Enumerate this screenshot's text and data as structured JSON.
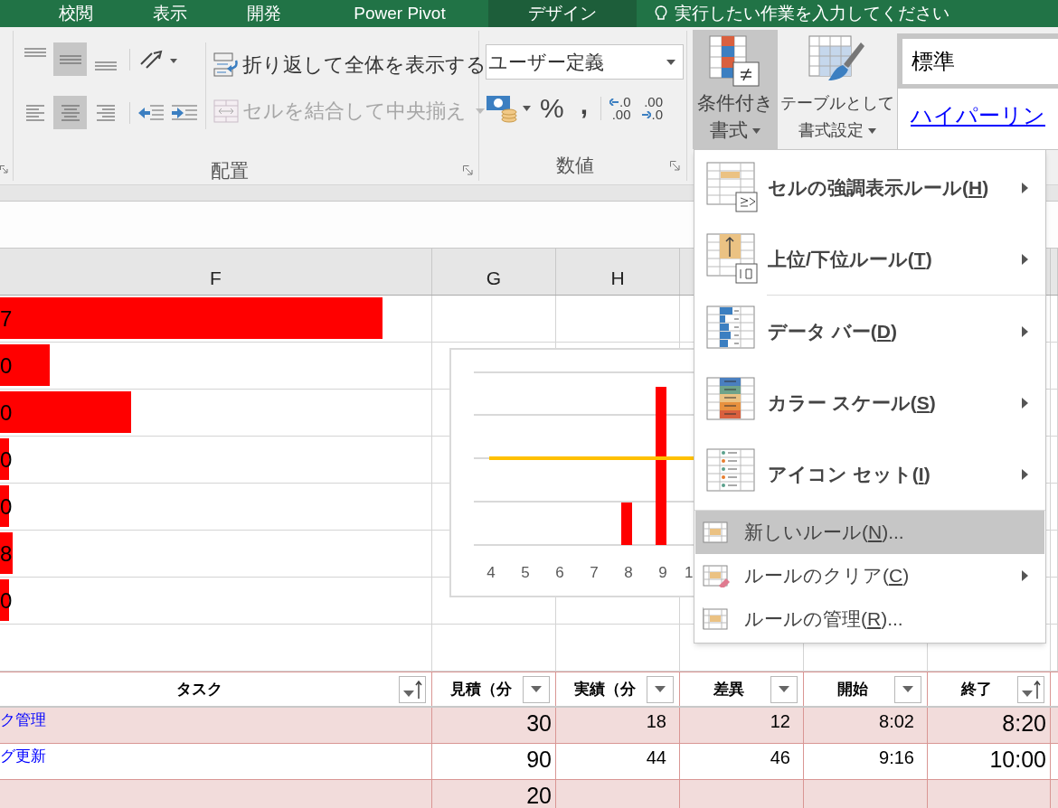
{
  "tabs": [
    {
      "label": "校閲",
      "selected": false
    },
    {
      "label": "表示",
      "selected": false
    },
    {
      "label": "開発",
      "selected": false
    },
    {
      "label": "Power Pivot",
      "selected": false
    },
    {
      "label": "デザイン",
      "selected": true
    }
  ],
  "tell_me": "実行したい作業を入力してください",
  "alignment": {
    "label": "配置",
    "vertical": [
      {
        "selected": false
      },
      {
        "selected": true
      },
      {
        "selected": false
      }
    ],
    "horizontal": [
      {
        "selected": false
      },
      {
        "selected": true
      },
      {
        "selected": false
      }
    ],
    "wrap_text": {
      "label": "折り返して全体を表示する"
    },
    "merge": {
      "label": "セルを結合して中央揃え",
      "disabled": true
    }
  },
  "number": {
    "label": "数値",
    "format": "ユーザー定義",
    "percent": "%",
    "comma": ",",
    "decimals": [
      {
        "top": ".0",
        "bottom": ".00"
      },
      {
        "top": ".00",
        "bottom": ".0"
      }
    ]
  },
  "styles": {
    "conditional_formatting": {
      "lines": [
        "条件付き",
        "書式"
      ],
      "expanded": true
    },
    "format_as_table": {
      "lines": [
        "テーブルとして",
        "書式設定"
      ]
    },
    "cell_styles": [
      {
        "kind": "normal",
        "label": "標準"
      },
      {
        "kind": "hyperlink",
        "label": "ハイパーリン"
      }
    ]
  },
  "columns": [
    "F",
    "G",
    "H"
  ],
  "data_bars": [
    {
      "text": "7",
      "level": 0.887
    },
    {
      "text": "0",
      "level": 0.115
    },
    {
      "text": "0",
      "level": 0.303
    },
    {
      "text": "0",
      "level": 0.021
    },
    {
      "text": "0",
      "level": 0.021
    },
    {
      "text": "8",
      "level": 0.029
    },
    {
      "text": "0",
      "level": 0.021
    }
  ],
  "chart": {
    "x_labels": [
      "4",
      "5",
      "6",
      "7",
      "8",
      "9",
      "1"
    ]
  },
  "menu": {
    "items": [
      {
        "kind": "large",
        "before": "セルの強調表示ルール(",
        "key": "H",
        "after": ")",
        "submenu": true,
        "selected": false,
        "divider_above": false
      },
      {
        "kind": "large",
        "before": "上位/下位ルール(",
        "key": "T",
        "after": ")",
        "submenu": true,
        "selected": false,
        "divider_above": false
      },
      {
        "kind": "large",
        "before": "データ バー(",
        "key": "D",
        "after": ")",
        "submenu": true,
        "selected": false,
        "divider_above": true
      },
      {
        "kind": "large",
        "before": "カラー スケール(",
        "key": "S",
        "after": ")",
        "submenu": true,
        "selected": false,
        "divider_above": false
      },
      {
        "kind": "large",
        "before": "アイコン セット(",
        "key": "I",
        "after": ")",
        "submenu": true,
        "selected": false,
        "divider_above": false
      },
      {
        "kind": "small",
        "before": "新しいルール(",
        "key": "N",
        "after": ")...",
        "submenu": false,
        "selected": true,
        "divider_above": true
      },
      {
        "kind": "small",
        "before": "ルールのクリア(",
        "key": "C",
        "after": ")",
        "submenu": true,
        "selected": false,
        "divider_above": false
      },
      {
        "kind": "small",
        "before": "ルールの管理(",
        "key": "R",
        "after": ")...",
        "submenu": false,
        "selected": false,
        "divider_above": false
      }
    ]
  },
  "table": {
    "columns": [
      {
        "label": "タスク",
        "kind": "link",
        "sorted": true
      },
      {
        "label": "見積（分",
        "kind": "large",
        "sorted": false
      },
      {
        "label": "実績（分",
        "kind": "number",
        "sorted": false
      },
      {
        "label": "差異",
        "kind": "number",
        "sorted": false
      },
      {
        "label": "開始",
        "kind": "number",
        "sorted": false
      },
      {
        "label": "終了",
        "kind": "large",
        "sorted": true
      }
    ],
    "rows": [
      {
        "shaded": true,
        "cells": [
          "ク管理",
          "30",
          "18",
          "12",
          "8:02",
          "8:20"
        ]
      },
      {
        "shaded": false,
        "cells": [
          "グ更新",
          "90",
          "44",
          "46",
          "9:16",
          "10:00"
        ]
      },
      {
        "shaded": true,
        "cells": [
          null,
          "20",
          null,
          null,
          null,
          null
        ]
      }
    ]
  }
}
